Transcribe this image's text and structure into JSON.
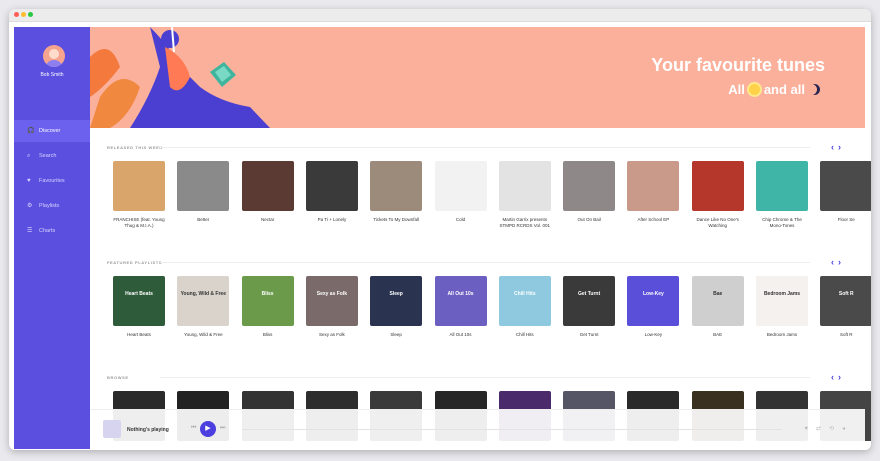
{
  "user": {
    "name": "Bob Smith"
  },
  "nav": [
    {
      "label": "Discover",
      "icon": "headphones-icon",
      "active": true
    },
    {
      "label": "Search",
      "icon": "search-icon"
    },
    {
      "label": "Favourites",
      "icon": "heart-icon"
    },
    {
      "label": "Playlists",
      "icon": "playlist-icon"
    },
    {
      "label": "Charts",
      "icon": "chart-icon"
    }
  ],
  "banner": {
    "title": "Your favourite tunes",
    "sub_a": "All",
    "sub_b": "and all"
  },
  "sections": {
    "released": {
      "title": "RELEASED THIS WEEK"
    },
    "featured": {
      "title": "FEATURED PLAYLISTS"
    },
    "browse": {
      "title": "BROWSE"
    }
  },
  "released": [
    {
      "label": "FRANCHISE (feat. Young Thug & M.I.A.)",
      "color": "#d9a56a"
    },
    {
      "label": "Better",
      "color": "#8a8a8a"
    },
    {
      "label": "Nectar",
      "color": "#5a3a33"
    },
    {
      "label": "Pa Ti + Lonely",
      "color": "#3a3a3a"
    },
    {
      "label": "Tickets To My Downfall",
      "color": "#9c8a7a"
    },
    {
      "label": "Cold",
      "color": "#f2f2f2"
    },
    {
      "label": "Martin Garrix presents STMPD RCRDS Vol. 001",
      "color": "#e3e3e3"
    },
    {
      "label": "Out On Bail",
      "color": "#8e8888"
    },
    {
      "label": "After School EP",
      "color": "#c99a8a"
    },
    {
      "label": "Dance Like No One's Watching",
      "color": "#b5362a"
    },
    {
      "label": "Chip Chrome & The Mono-Tones",
      "color": "#3fb5a8"
    },
    {
      "label": "Floor Se",
      "color": "#4a4a4a"
    }
  ],
  "playlists": [
    {
      "label": "Heart Beats",
      "overlay": "Heart Beats",
      "color": "#2e5c3a"
    },
    {
      "label": "Young, Wild & Free",
      "overlay": "Young, Wild & Free",
      "color": "#d9d3cc"
    },
    {
      "label": "Bliss",
      "overlay": "Bliss",
      "color": "#6a9a4a"
    },
    {
      "label": "Sexy as Folk",
      "overlay": "Sexy as Folk",
      "color": "#7a6a6a"
    },
    {
      "label": "Sleep",
      "overlay": "Sleep",
      "color": "#2a3450"
    },
    {
      "label": "All Out 10s",
      "overlay": "All Out 10s",
      "color": "#6b5fc2"
    },
    {
      "label": "Chill Hits",
      "overlay": "Chill Hits",
      "color": "#8ec9e0"
    },
    {
      "label": "Get Turnt",
      "overlay": "Get Turnt",
      "color": "#3a3a3a"
    },
    {
      "label": "Low-Key",
      "overlay": "Low-Key",
      "color": "#5a4fd8"
    },
    {
      "label": "BAE",
      "overlay": "Bae",
      "color": "#cfcfcf"
    },
    {
      "label": "Bedroom Jams",
      "overlay": "Bedroom Jams",
      "color": "#f4f1ee"
    },
    {
      "label": "Soft R",
      "overlay": "Soft R",
      "color": "#4a4a4a"
    }
  ],
  "browse_colors": [
    "#2a2a2a",
    "#222",
    "#333",
    "#2d2d2d",
    "#3a3a3a",
    "#262626",
    "#4a2a6a",
    "#556",
    "#2a2a2a",
    "#3a3020",
    "#333",
    "#444"
  ],
  "player": {
    "text": "Nothing's playing"
  },
  "colors": {
    "accent": "#5b4fe0",
    "banner": "#fbb09c"
  }
}
